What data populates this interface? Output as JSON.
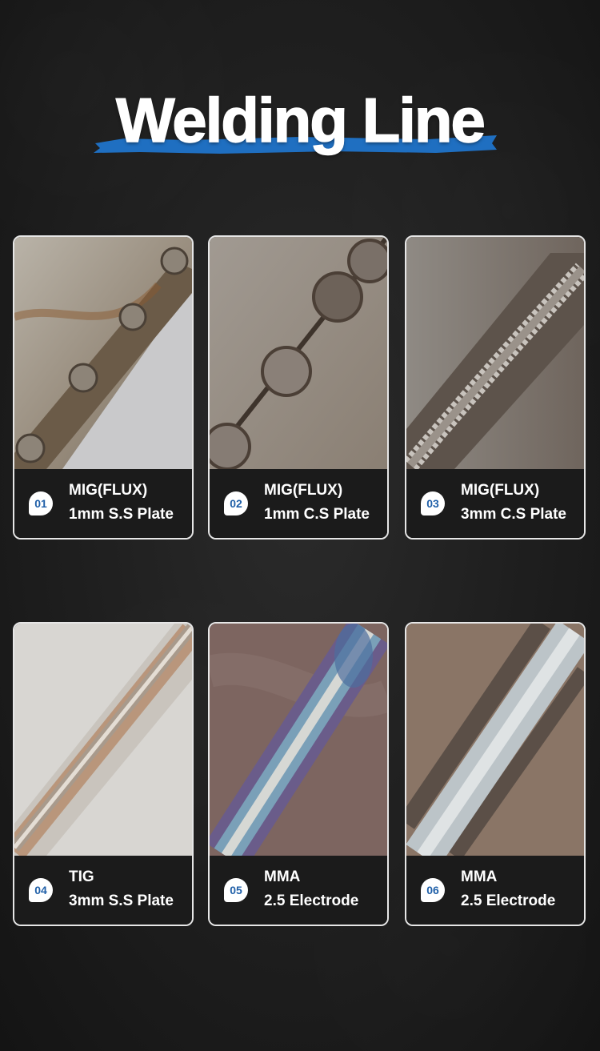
{
  "header": {
    "title": "Welding Line",
    "accent_color": "#1f6fc1"
  },
  "cards": [
    {
      "number": "01",
      "process": "MIG(FLUX)",
      "material": "1mm S.S Plate"
    },
    {
      "number": "02",
      "process": "MIG(FLUX)",
      "material": "1mm C.S Plate"
    },
    {
      "number": "03",
      "process": "MIG(FLUX)",
      "material": "3mm C.S Plate"
    },
    {
      "number": "04",
      "process": "TIG",
      "material": "3mm S.S Plate"
    },
    {
      "number": "05",
      "process": "MMA",
      "material": "2.5 Electrode"
    },
    {
      "number": "06",
      "process": "MMA",
      "material": "2.5 Electrode"
    }
  ]
}
